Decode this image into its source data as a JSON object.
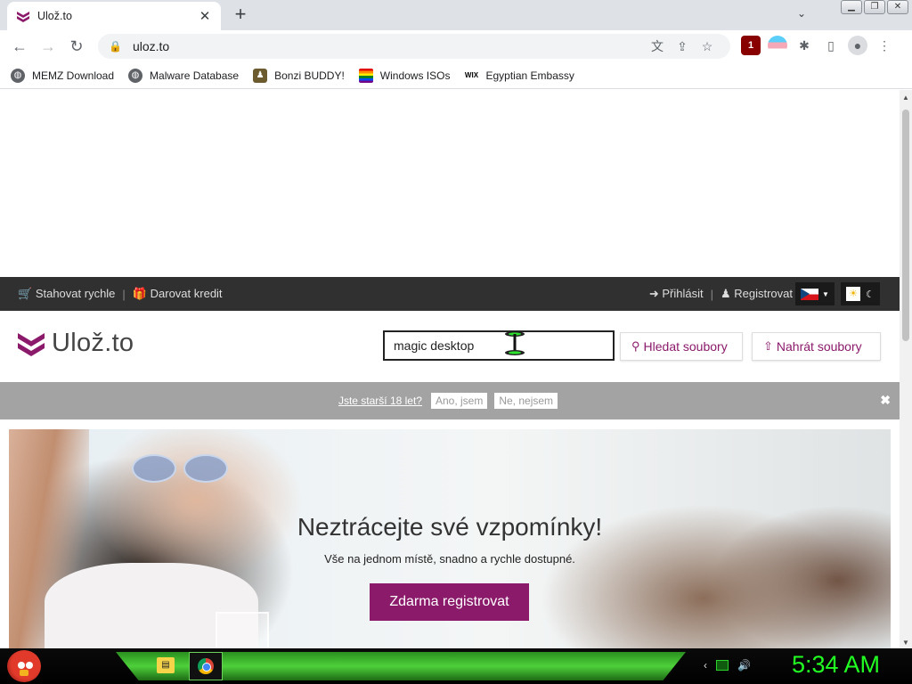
{
  "browser": {
    "tab_title": "Ulož.to",
    "url": "uloz.to",
    "bookmarks": [
      {
        "label": "MEMZ Download",
        "icon": "globe-icon"
      },
      {
        "label": "Malware Database",
        "icon": "globe-icon"
      },
      {
        "label": "Bonzi BUDDY!",
        "icon": "bonzi-icon"
      },
      {
        "label": "Windows ISOs",
        "icon": "rainbow-flag-icon"
      },
      {
        "label": "Egyptian Embassy",
        "icon": "wix-icon"
      }
    ],
    "extension_badge": "1"
  },
  "site": {
    "topbar": {
      "fast_download": "Stahovat rychle",
      "donate_credit": "Darovat kredit",
      "login": "Přihlásit",
      "register": "Registrovat"
    },
    "logo_text": "Ulož.to",
    "search": {
      "value": "magic desktop",
      "button": "Hledat soubory"
    },
    "upload_button": "Nahrát soubory",
    "age_check": {
      "question": "Jste starší 18 let?",
      "yes": "Ano, jsem",
      "no": "Ne, nejsem"
    },
    "hero": {
      "title": "Neztrácejte své vzpomínky!",
      "subtitle": "Vše na jednom místě, snadno a rychle dostupné.",
      "cta": "Zdarma registrovat"
    },
    "brand_color": "#8b1a6b"
  },
  "taskbar": {
    "clock": "5:34 AM"
  }
}
